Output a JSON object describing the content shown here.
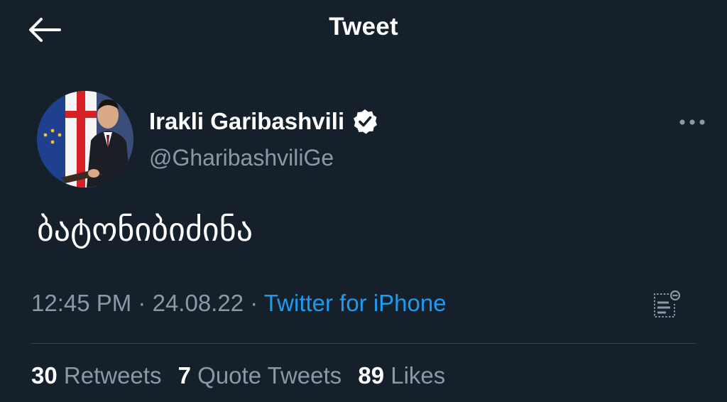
{
  "header": {
    "title": "Tweet",
    "back_icon": "arrow-left-icon"
  },
  "author": {
    "name": "Irakli Garibashvili",
    "handle": "@GharibashviliGe",
    "verified_icon": "verified-badge-icon"
  },
  "tweet": {
    "text": "ბატონიბიძინა"
  },
  "meta": {
    "time": "12:45 PM",
    "separator": "·",
    "date": "24.08.22",
    "source": "Twitter for iPhone"
  },
  "stats": {
    "retweets_count": "30",
    "retweets_label": "Retweets",
    "quotes_count": "7",
    "quotes_label": "Quote Tweets",
    "likes_count": "89",
    "likes_label": "Likes"
  },
  "colors": {
    "background": "#15202b",
    "text": "#ffffff",
    "secondary_text": "#8b98a5",
    "link": "#1d9bf0",
    "divider": "#38444d"
  }
}
